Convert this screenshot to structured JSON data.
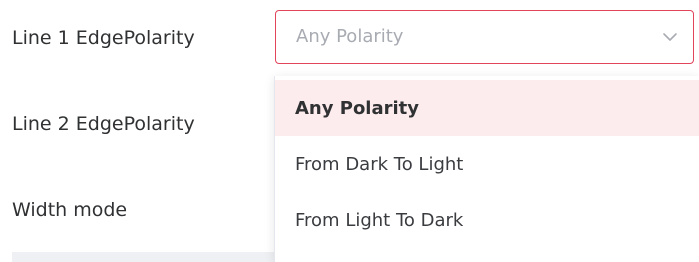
{
  "form": {
    "labels": [
      "Line 1 EdgePolarity",
      "Line 2 EdgePolarity",
      "Width mode"
    ]
  },
  "select": {
    "value": "Any Polarity",
    "arrow_icon": "chevron-down-icon",
    "focus_border_color": "#e2445c"
  },
  "dropdown": {
    "options": [
      "Any Polarity",
      "From Dark To Light",
      "From Light To Dark"
    ],
    "selected": "Any Polarity",
    "selected_bg_color": "#fdeced"
  }
}
